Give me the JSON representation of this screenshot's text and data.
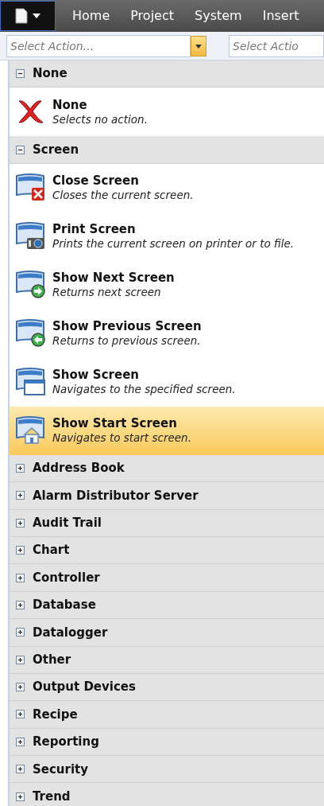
{
  "menu_tabs": [
    {
      "label": "Home"
    },
    {
      "label": "Project"
    },
    {
      "label": "System"
    },
    {
      "label": "Insert"
    }
  ],
  "action_selectors": [
    {
      "placeholder": "Select Action..."
    },
    {
      "placeholder": "Select Actio"
    }
  ],
  "groups": [
    {
      "title": "None",
      "expanded": true,
      "items": [
        {
          "kind": "none",
          "title": "None",
          "description": "Selects no action.",
          "selected": false
        }
      ]
    },
    {
      "title": "Screen",
      "expanded": true,
      "items": [
        {
          "kind": "close",
          "title": "Close Screen",
          "description": "Closes the current screen.",
          "selected": false
        },
        {
          "kind": "print",
          "title": "Print Screen",
          "description": "Prints the current screen on printer or to file.",
          "selected": false
        },
        {
          "kind": "next",
          "title": "Show Next Screen",
          "description": "Returns next screen",
          "selected": false
        },
        {
          "kind": "previous",
          "title": "Show Previous Screen",
          "description": "Returns to previous screen.",
          "selected": false
        },
        {
          "kind": "window",
          "title": "Show Screen",
          "description": "Navigates to the specified screen.",
          "selected": false
        },
        {
          "kind": "home",
          "title": "Show Start Screen",
          "description": "Navigates to start screen.",
          "selected": true
        }
      ]
    },
    {
      "title": "Address Book",
      "expanded": false
    },
    {
      "title": "Alarm Distributor Server",
      "expanded": false
    },
    {
      "title": "Audit Trail",
      "expanded": false
    },
    {
      "title": "Chart",
      "expanded": false
    },
    {
      "title": "Controller",
      "expanded": false
    },
    {
      "title": "Database",
      "expanded": false
    },
    {
      "title": "Datalogger",
      "expanded": false
    },
    {
      "title": "Other",
      "expanded": false
    },
    {
      "title": "Output Devices",
      "expanded": false
    },
    {
      "title": "Recipe",
      "expanded": false
    },
    {
      "title": "Reporting",
      "expanded": false
    },
    {
      "title": "Security",
      "expanded": false
    },
    {
      "title": "Trend",
      "expanded": false
    }
  ]
}
